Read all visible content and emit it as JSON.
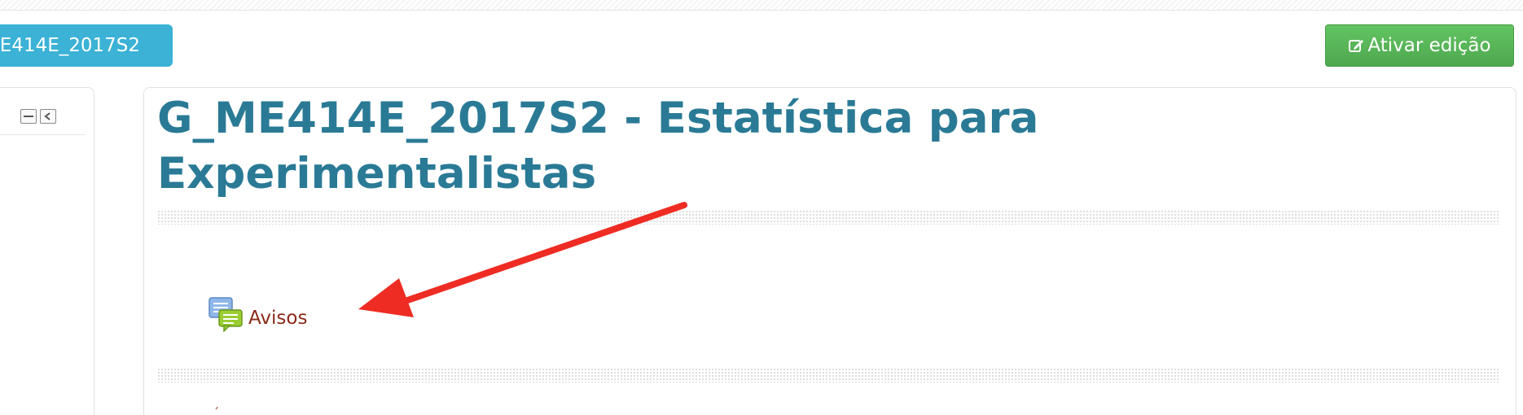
{
  "header": {
    "course_shortname": "E414E_2017S2",
    "edit_button_label": "Ativar edição"
  },
  "block": {
    "dock_icon": "minus-square-icon",
    "move_icon": "chevron-left-square-icon"
  },
  "course": {
    "title": "G_ME414E_2017S2 - Estatística para Experimentalistas",
    "activities": [
      {
        "type": "forum",
        "icon": "forum-icon",
        "label": "Avisos"
      }
    ]
  },
  "colors": {
    "title": "#2a7a96",
    "course_pill": "#3bb2d6",
    "edit_button": "#5cb85c",
    "activity_link": "#8a2a17",
    "annotation_arrow": "#ee2c24"
  }
}
